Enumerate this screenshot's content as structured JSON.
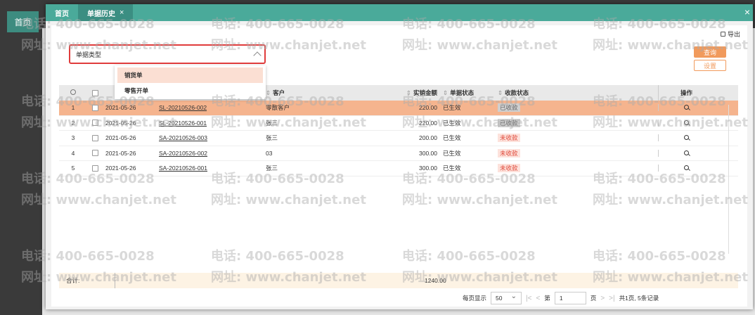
{
  "background": {
    "home_tab": "首页"
  },
  "modal": {
    "tabs": [
      {
        "label": "首页"
      },
      {
        "label": "单据历史",
        "close": "×"
      }
    ],
    "close": "×"
  },
  "toolbar": {
    "export_label": "导出",
    "query_label": "查询",
    "settings_label": "设置"
  },
  "filter": {
    "label": "单据类型",
    "options": [
      "销货单",
      "零售开单"
    ],
    "highlighted_option": "销货单"
  },
  "table": {
    "headers": {
      "customer": "客户",
      "amount": "实销金额",
      "doc_status": "单据状态",
      "pay_status": "收款状态",
      "action": "操作"
    },
    "rows": [
      {
        "idx": "1",
        "date": "2021-05-26",
        "no": "SL-20210526-002",
        "customer": "零散客户",
        "amount": "220.00",
        "doc_status": "已生效",
        "pay_status": "已收款"
      },
      {
        "idx": "2",
        "date": "2021-05-26",
        "no": "SL-20210526-001",
        "customer": "张三",
        "amount": "220.00",
        "doc_status": "已生效",
        "pay_status": "已收款"
      },
      {
        "idx": "3",
        "date": "2021-05-26",
        "no": "SA-20210526-003",
        "customer": "张三",
        "amount": "200.00",
        "doc_status": "已生效",
        "pay_status": "未收款"
      },
      {
        "idx": "4",
        "date": "2021-05-26",
        "no": "SA-20210526-002",
        "customer": "03",
        "amount": "300.00",
        "doc_status": "已生效",
        "pay_status": "未收款"
      },
      {
        "idx": "5",
        "date": "2021-05-26",
        "no": "SA-20210526-001",
        "customer": "张三",
        "amount": "300.00",
        "doc_status": "已生效",
        "pay_status": "未收款"
      }
    ],
    "total_label": "合计:",
    "total_amount": "1240.00"
  },
  "pager": {
    "per_page_label": "每页显示",
    "per_page_value": "50",
    "first": "|<",
    "prev": "<",
    "page_prefix": "第",
    "page_value": "1",
    "page_suffix": "页",
    "next": ">",
    "last": ">|",
    "summary": "共1页, 5条记录"
  },
  "watermark": {
    "phone": "电话: 400-665-0028",
    "site": "网址: www.chanjet.net"
  },
  "colors": {
    "accent": "#4aaa9a",
    "highlight_row": "#f5b48e",
    "button": "#f19a5c",
    "unpaid": "#e0493a"
  }
}
